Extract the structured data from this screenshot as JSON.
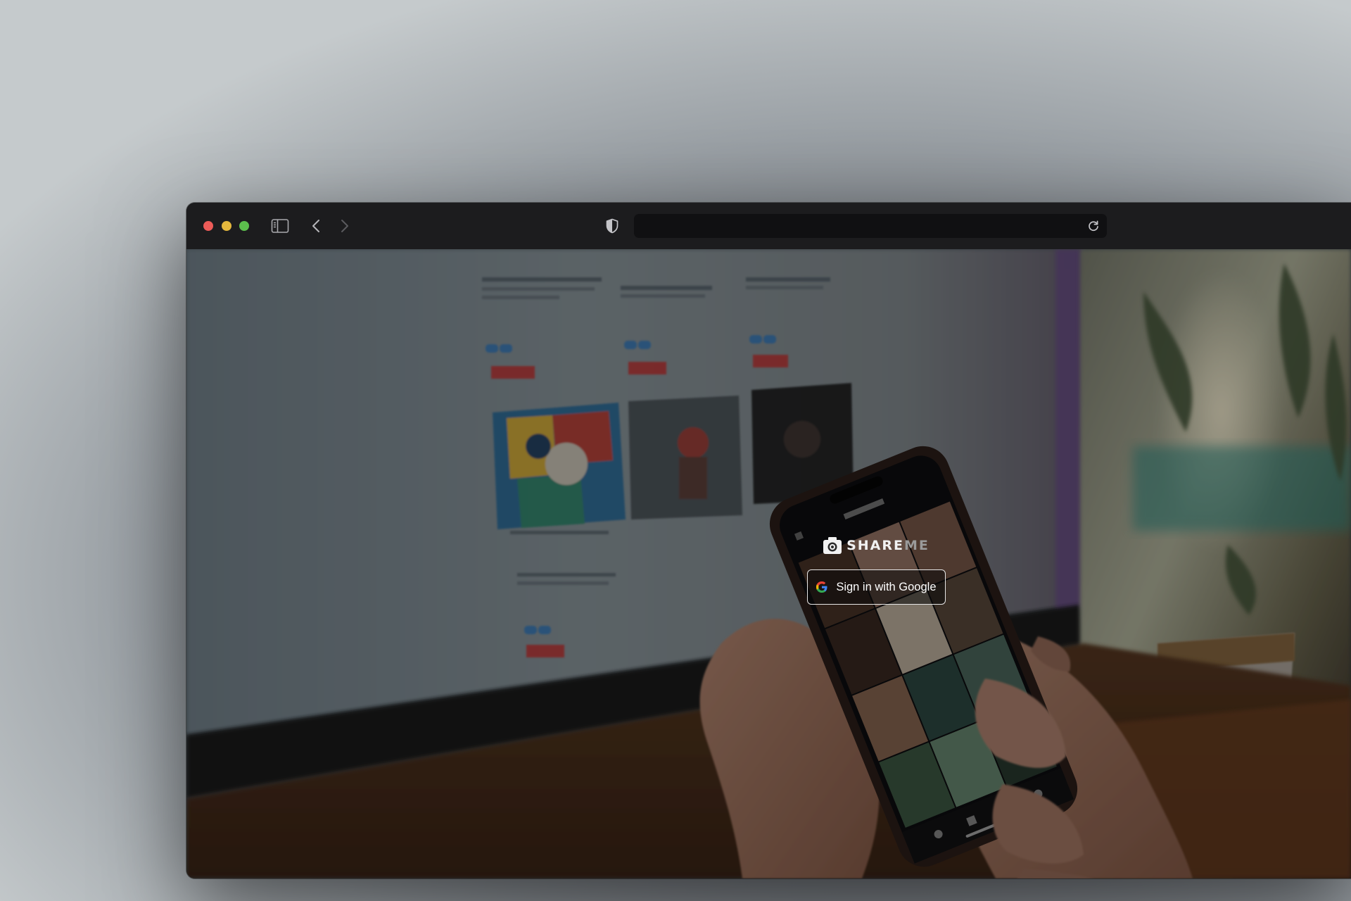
{
  "browser": {
    "window_controls": [
      "close",
      "minimize",
      "zoom"
    ],
    "toolbar_icons": {
      "sidebar": "sidebar-icon",
      "back": "chevron-left-icon",
      "forward": "chevron-right-icon",
      "privacy": "shield-icon",
      "reload": "reload-icon"
    },
    "address_bar": {
      "value": ""
    }
  },
  "app": {
    "logo": {
      "icon": "camera-icon",
      "text_main": "SHARE",
      "text_accent": "ME"
    },
    "sign_in_button": {
      "icon": "google-icon",
      "label": "Sign in with Google"
    }
  },
  "colors": {
    "traffic_close": "#ec5b58",
    "traffic_minimize": "#e4b73d",
    "traffic_zoom": "#5cbf4d",
    "toolbar_bg": "#1c1c1e",
    "overlay": "rgba(0,0,0,0.36)"
  },
  "background_image": {
    "subject": "hands holding smartphone in front of a desktop monitor with plant"
  }
}
